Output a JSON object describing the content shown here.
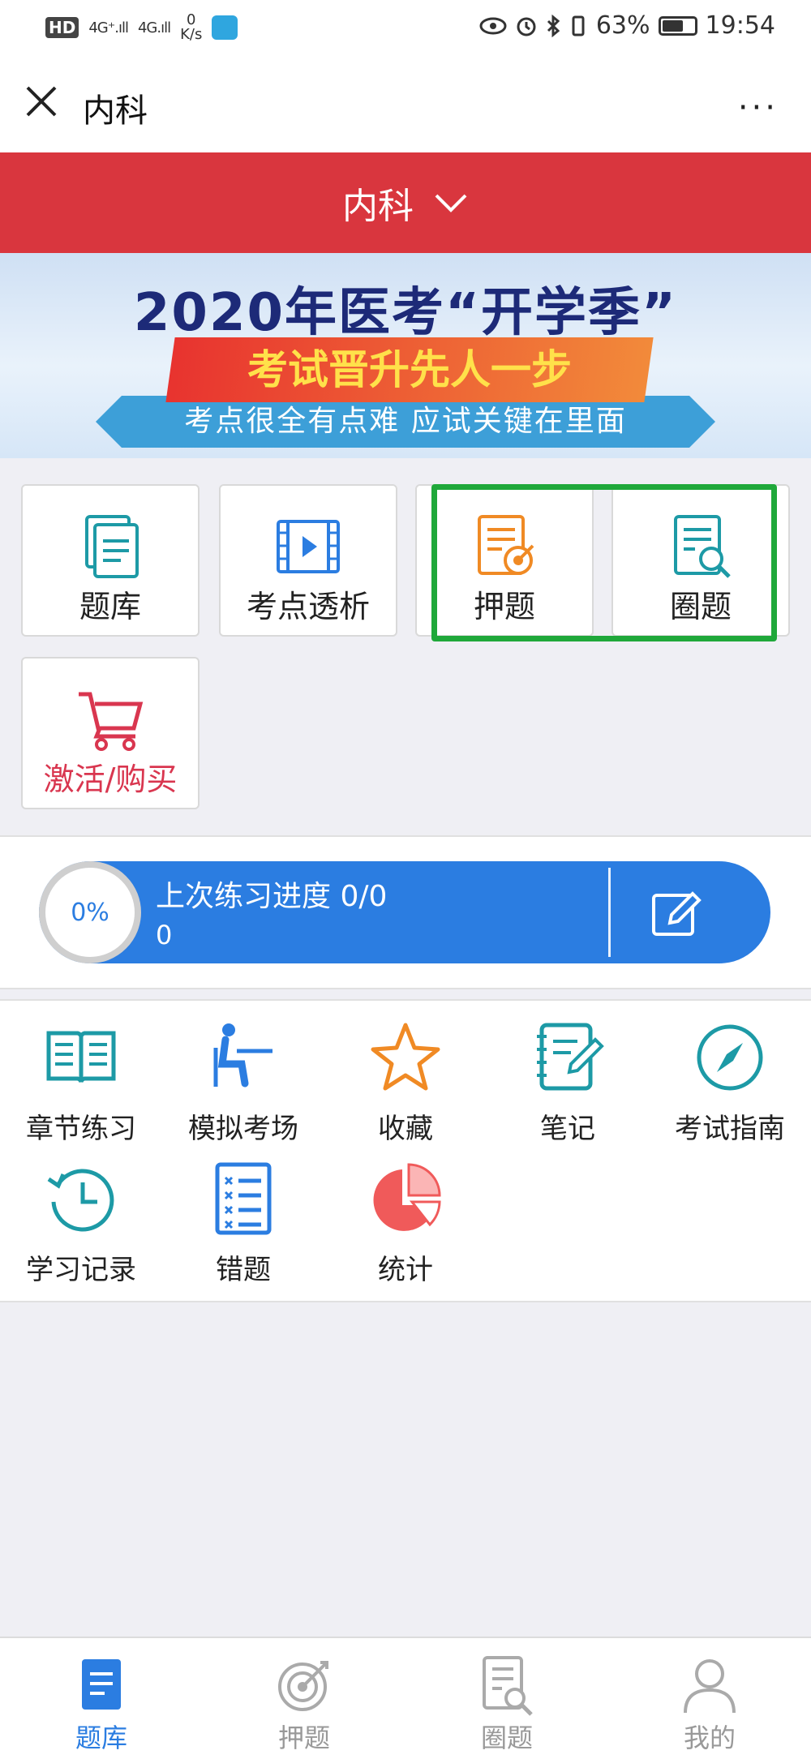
{
  "status_bar": {
    "hd_label": "HD",
    "signal1": "4G⁺.ıll",
    "signal2": "4G.ıll",
    "net_speed_value": "0",
    "net_speed_unit": "K/s",
    "battery_percent": "63%",
    "time": "19:54"
  },
  "title_bar": {
    "title": "内科",
    "more_label": "···"
  },
  "header": {
    "subject": "内科"
  },
  "banner": {
    "headline": "2020年医考“开学季”",
    "tagline": "考试晋升先人一步",
    "subline": "考点很全有点难  应试关键在里面"
  },
  "tiles": [
    {
      "label": "题库"
    },
    {
      "label": "考点透析"
    },
    {
      "label": "押题"
    },
    {
      "label": "圈题"
    },
    {
      "label": "激活/购买"
    }
  ],
  "progress": {
    "percent_text": "0%",
    "percent_value": 0,
    "title": "上次练习进度 0/0",
    "count": "0"
  },
  "features": [
    {
      "label": "章节练习",
      "icon": "book-icon"
    },
    {
      "label": "模拟考场",
      "icon": "exam-seat-icon"
    },
    {
      "label": "收藏",
      "icon": "star-icon"
    },
    {
      "label": "笔记",
      "icon": "notebook-icon"
    },
    {
      "label": "考试指南",
      "icon": "compass-icon"
    },
    {
      "label": "学习记录",
      "icon": "history-icon"
    },
    {
      "label": "错题",
      "icon": "wrong-list-icon"
    },
    {
      "label": "统计",
      "icon": "pie-chart-icon"
    }
  ],
  "bottom_nav": [
    {
      "label": "题库",
      "active": true
    },
    {
      "label": "押题",
      "active": false
    },
    {
      "label": "圈题",
      "active": false
    },
    {
      "label": "我的",
      "active": false
    }
  ],
  "colors": {
    "header_red": "#d9363e",
    "accent_blue": "#2b7de1",
    "teal_icon": "#1d9aa6",
    "highlight_green": "#1fa83a",
    "buy_red": "#d9364f"
  }
}
